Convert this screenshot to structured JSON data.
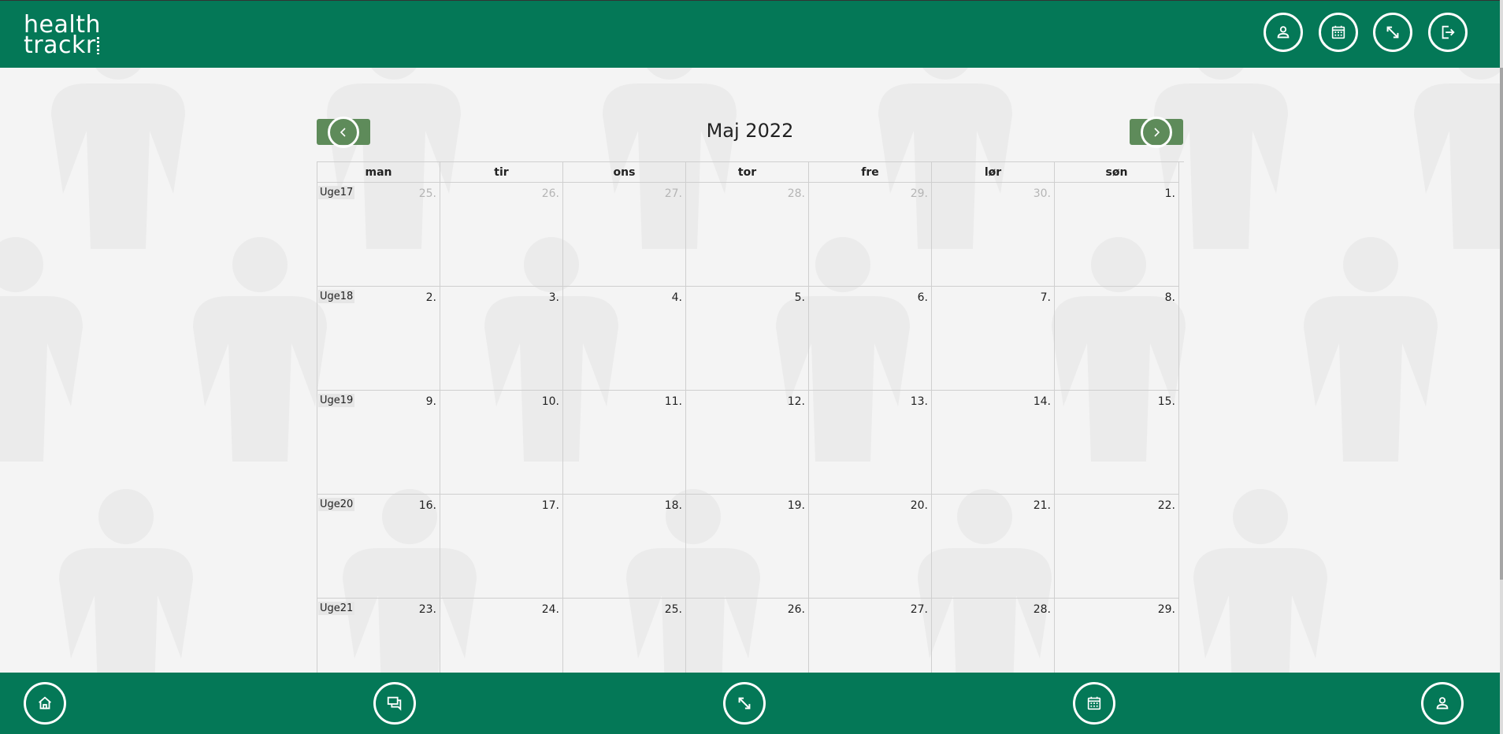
{
  "app": {
    "logo_line1": "health",
    "logo_line2": "trackr",
    "brand_color": "#047857",
    "accent_color": "#5e8b5a"
  },
  "header": {
    "buttons": [
      {
        "name": "profile-icon"
      },
      {
        "name": "calendar-icon"
      },
      {
        "name": "expand-icon"
      },
      {
        "name": "logout-icon"
      }
    ]
  },
  "calendar": {
    "title": "Maj 2022",
    "prev_icon": "chevron-left-icon",
    "next_icon": "chevron-right-icon",
    "weekdays": [
      "man",
      "tir",
      "ons",
      "tor",
      "fre",
      "lør",
      "søn"
    ],
    "weeks": [
      {
        "label": "Uge17",
        "days": [
          {
            "n": "25.",
            "other": true
          },
          {
            "n": "26.",
            "other": true
          },
          {
            "n": "27.",
            "other": true
          },
          {
            "n": "28.",
            "other": true
          },
          {
            "n": "29.",
            "other": true
          },
          {
            "n": "30.",
            "other": true
          },
          {
            "n": "1.",
            "other": false
          }
        ]
      },
      {
        "label": "Uge18",
        "days": [
          {
            "n": "2."
          },
          {
            "n": "3."
          },
          {
            "n": "4."
          },
          {
            "n": "5."
          },
          {
            "n": "6."
          },
          {
            "n": "7."
          },
          {
            "n": "8."
          }
        ]
      },
      {
        "label": "Uge19",
        "days": [
          {
            "n": "9."
          },
          {
            "n": "10."
          },
          {
            "n": "11."
          },
          {
            "n": "12."
          },
          {
            "n": "13."
          },
          {
            "n": "14."
          },
          {
            "n": "15."
          }
        ]
      },
      {
        "label": "Uge20",
        "days": [
          {
            "n": "16."
          },
          {
            "n": "17."
          },
          {
            "n": "18."
          },
          {
            "n": "19."
          },
          {
            "n": "20."
          },
          {
            "n": "21."
          },
          {
            "n": "22."
          }
        ]
      },
      {
        "label": "Uge21",
        "days": [
          {
            "n": "23."
          },
          {
            "n": "24."
          },
          {
            "n": "25."
          },
          {
            "n": "26."
          },
          {
            "n": "27."
          },
          {
            "n": "28."
          },
          {
            "n": "29."
          }
        ]
      }
    ]
  },
  "bottom_nav": {
    "buttons": [
      {
        "name": "home-icon"
      },
      {
        "name": "messages-icon"
      },
      {
        "name": "expand-icon"
      },
      {
        "name": "calendar-icon"
      },
      {
        "name": "profile-icon"
      }
    ]
  }
}
